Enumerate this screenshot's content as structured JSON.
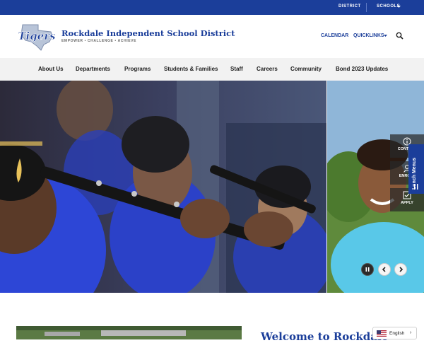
{
  "topbar": {
    "district": "DISTRICT",
    "schools": "SCHOOLS"
  },
  "header": {
    "site_name": "Rockdale Independent School District",
    "tagline": "EMPOWER • CHALLENGE • ACHIEVE",
    "logo_text": "Tigers",
    "calendar": "CALENDAR",
    "quicklinks": "QUICKLINKS"
  },
  "nav": [
    "About Us",
    "Departments",
    "Programs",
    "Students & Families",
    "Staff",
    "Careers",
    "Community",
    "Bond 2023 Updates"
  ],
  "side_tabs": {
    "contact": "CONTACT",
    "enroll": "ENROLL",
    "apply": "APPLY"
  },
  "lunch_tab": "Lunch Menus",
  "welcome": {
    "title": "Welcome to Rockdale"
  },
  "language": {
    "label": "English"
  },
  "colors": {
    "primary": "#1b3e9a",
    "nav_bg": "#f2f2f2"
  },
  "icons": {
    "search": "search-icon",
    "pause": "pause-icon",
    "prev": "chevron-left-icon",
    "next": "chevron-right-icon"
  }
}
